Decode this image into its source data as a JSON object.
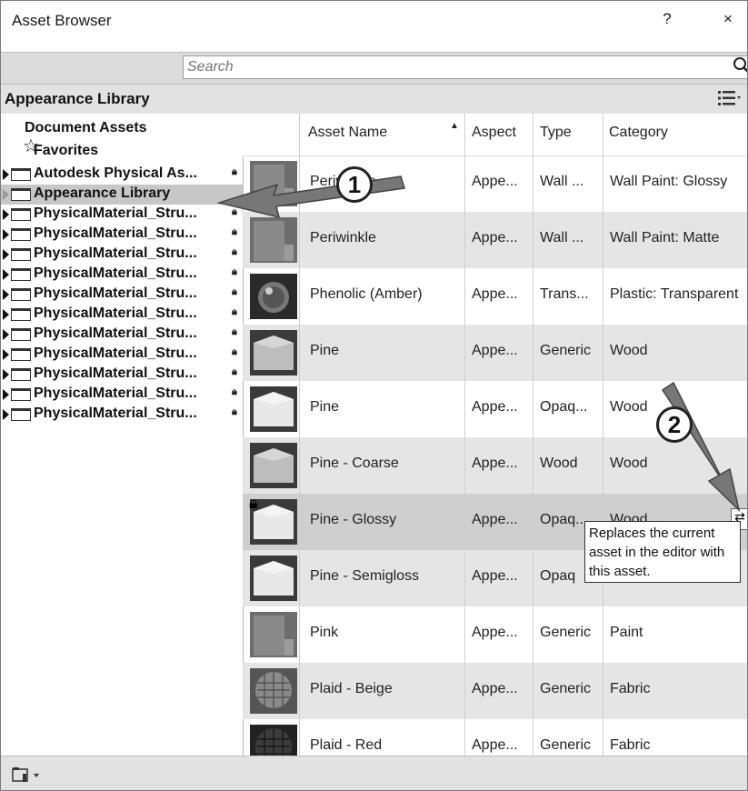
{
  "window": {
    "title": "Asset Browser",
    "help": "?",
    "close": "×"
  },
  "search": {
    "placeholder": "Search"
  },
  "library": {
    "title": "Appearance Library"
  },
  "sidebar": {
    "document_assets": "Document Assets",
    "favorites": "Favorites",
    "items": [
      {
        "label": "Autodesk Physical As...",
        "locked": true
      },
      {
        "label": "Appearance Library",
        "locked": false
      },
      {
        "label": "PhysicalMaterial_Stru...",
        "locked": true
      },
      {
        "label": "PhysicalMaterial_Stru...",
        "locked": true
      },
      {
        "label": "PhysicalMaterial_Stru...",
        "locked": true
      },
      {
        "label": "PhysicalMaterial_Stru...",
        "locked": true
      },
      {
        "label": "PhysicalMaterial_Stru...",
        "locked": true
      },
      {
        "label": "PhysicalMaterial_Stru...",
        "locked": true
      },
      {
        "label": "PhysicalMaterial_Stru...",
        "locked": true
      },
      {
        "label": "PhysicalMaterial_Stru...",
        "locked": true
      },
      {
        "label": "PhysicalMaterial_Stru...",
        "locked": true
      },
      {
        "label": "PhysicalMaterial_Stru...",
        "locked": true
      },
      {
        "label": "PhysicalMaterial_Stru...",
        "locked": true
      }
    ]
  },
  "table": {
    "headers": {
      "name": "Asset Name",
      "aspect": "Aspect",
      "type": "Type",
      "category": "Category"
    },
    "rows": [
      {
        "name": "Periwinkle",
        "aspect": "Appe...",
        "type": "Wall ...",
        "category": "Wall Paint: Glossy",
        "thumb": "wall"
      },
      {
        "name": "Periwinkle",
        "aspect": "Appe...",
        "type": "Wall ...",
        "category": "Wall Paint: Matte",
        "thumb": "wall"
      },
      {
        "name": "Phenolic (Amber)",
        "aspect": "Appe...",
        "type": "Trans...",
        "category": "Plastic: Transparent",
        "thumb": "sphere"
      },
      {
        "name": "Pine",
        "aspect": "Appe...",
        "type": "Generic",
        "category": "Wood",
        "thumb": "cube-dark"
      },
      {
        "name": "Pine",
        "aspect": "Appe...",
        "type": "Opaq...",
        "category": "Wood",
        "thumb": "cube-light"
      },
      {
        "name": "Pine - Coarse",
        "aspect": "Appe...",
        "type": "Wood",
        "category": "Wood",
        "thumb": "cube-dark"
      },
      {
        "name": "Pine - Glossy",
        "aspect": "Appe...",
        "type": "Opaq...",
        "category": "Wood",
        "thumb": "cube-light"
      },
      {
        "name": "Pine - Semigloss",
        "aspect": "Appe...",
        "type": "Opaq",
        "category": "",
        "thumb": "cube-light"
      },
      {
        "name": "Pink",
        "aspect": "Appe...",
        "type": "Generic",
        "category": "Paint",
        "thumb": "wall"
      },
      {
        "name": "Plaid - Beige",
        "aspect": "Appe...",
        "type": "Generic",
        "category": "Fabric",
        "thumb": "fabric"
      },
      {
        "name": "Plaid - Red",
        "aspect": "Appe...",
        "type": "Generic",
        "category": "Fabric",
        "thumb": "fabric-dark"
      }
    ]
  },
  "tooltip": {
    "text": "Replaces the current asset in the editor with this asset."
  },
  "callouts": {
    "one": "1",
    "two": "2"
  }
}
